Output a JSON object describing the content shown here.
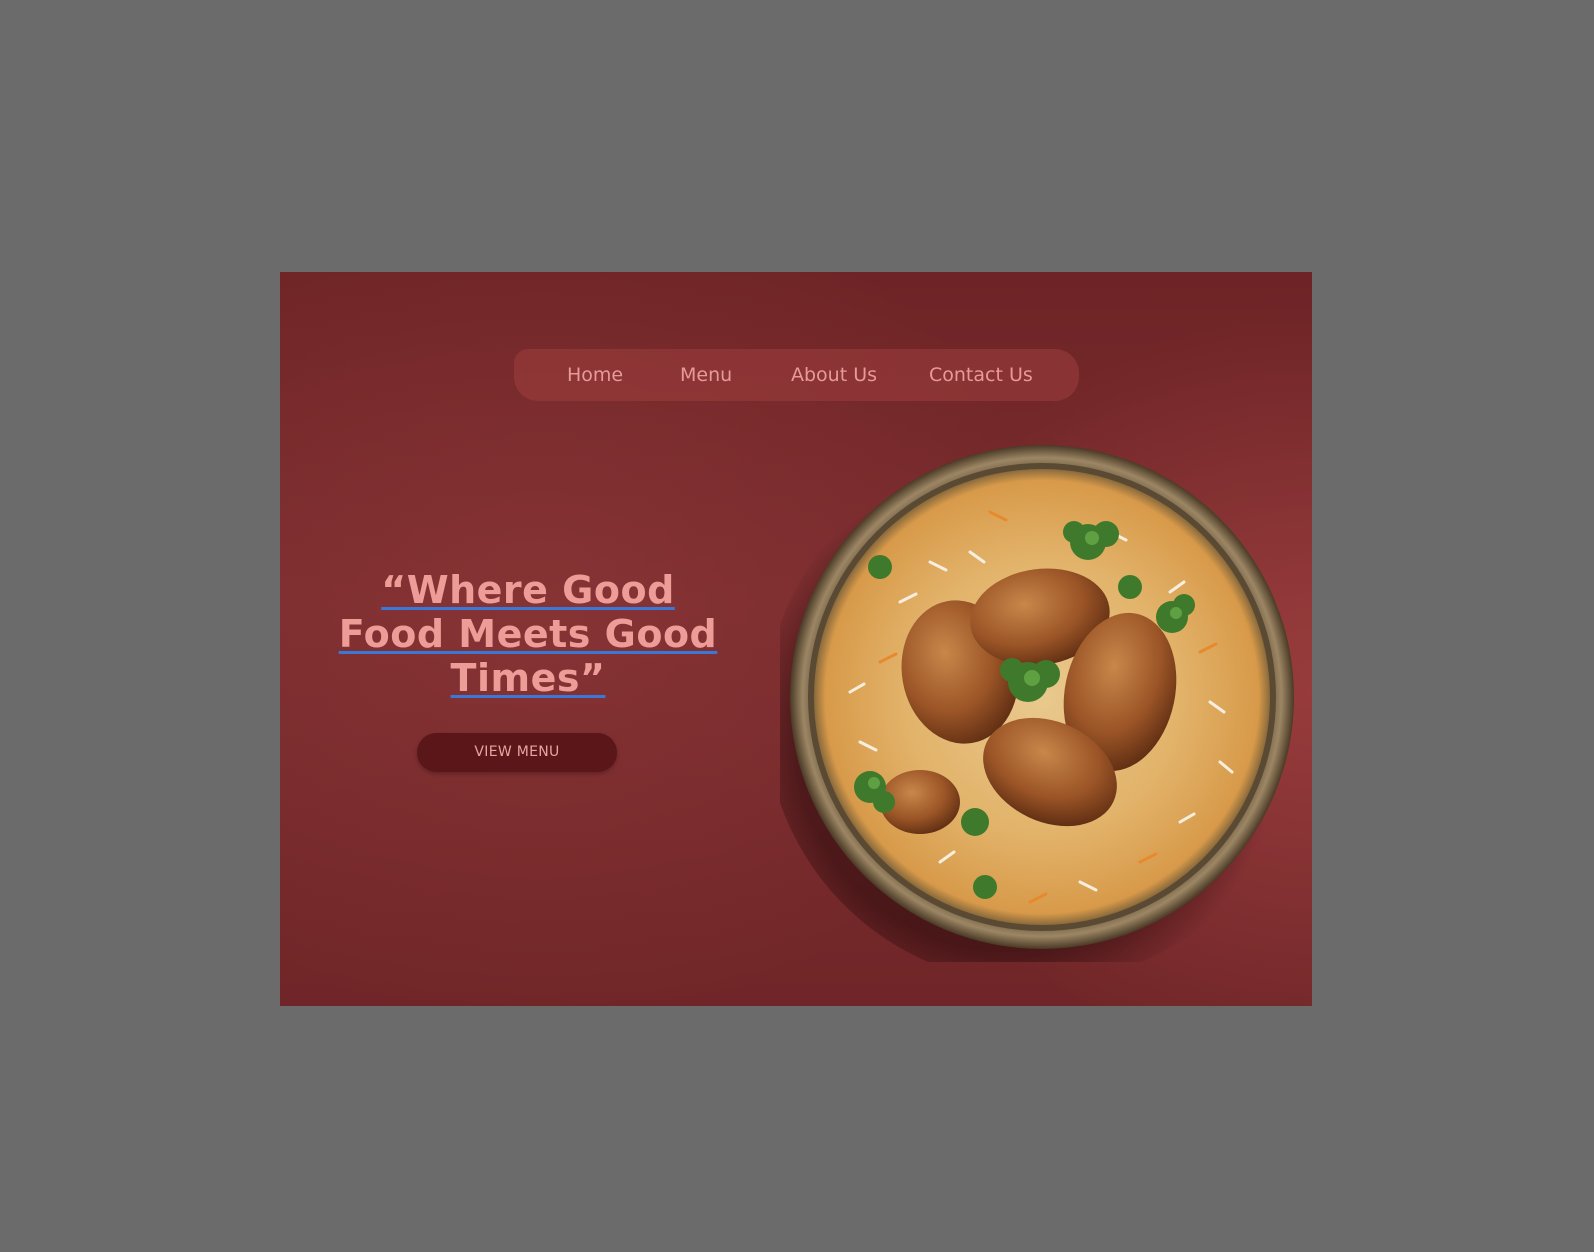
{
  "nav": {
    "items": [
      {
        "label": "Home"
      },
      {
        "label": "Menu"
      },
      {
        "label": "About Us"
      },
      {
        "label": "Contact Us"
      }
    ]
  },
  "hero": {
    "headline_line1": "“Where Good",
    "headline_line2": "Food Meets Good",
    "headline_line3": "Times”",
    "cta_label": "VIEW MENU"
  },
  "image": {
    "subject": "biryani-plate-image"
  },
  "colors": {
    "page_background": "#6b6b6b",
    "hero_background": "#742a2c",
    "nav_background": "#8e3838",
    "text_pink": "#ee9c98",
    "underline_blue": "#3a78d8",
    "button_background": "#5a1618"
  }
}
